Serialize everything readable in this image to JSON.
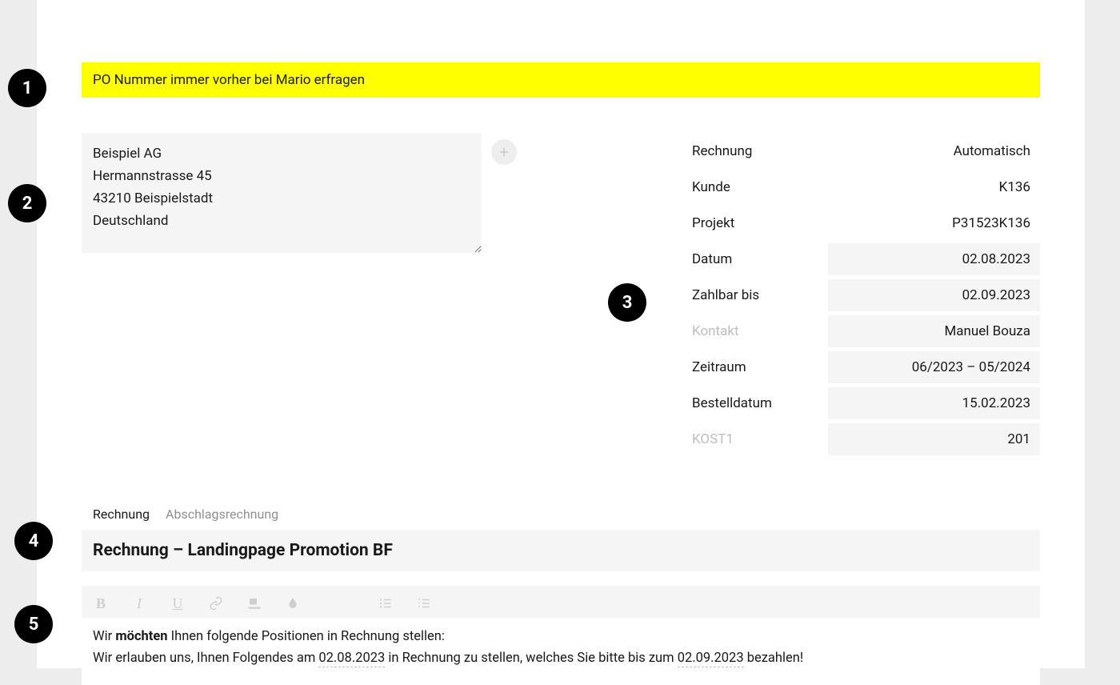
{
  "banner_text": "PO Nummer immer vorher bei Mario erfragen",
  "address_text": "Beispiel AG\nHermannstrasse 45\n43210 Beispielstadt\nDeutschland",
  "meta": {
    "rows": [
      {
        "label": "Rechnung",
        "value": "Automatisch",
        "boxed": false,
        "muted": false
      },
      {
        "label": "Kunde",
        "value": "K136",
        "boxed": false,
        "muted": false
      },
      {
        "label": "Projekt",
        "value": "P31523K136",
        "boxed": false,
        "muted": false
      },
      {
        "label": "Datum",
        "value": "02.08.2023",
        "boxed": true,
        "muted": false
      },
      {
        "label": "Zahlbar bis",
        "value": "02.09.2023",
        "boxed": true,
        "muted": false
      },
      {
        "label": "Kontakt",
        "value": "Manuel Bouza",
        "boxed": true,
        "muted": true
      },
      {
        "label": "Zeitraum",
        "value": "06/2023 – 05/2024",
        "boxed": true,
        "muted": false
      },
      {
        "label": "Bestelldatum",
        "value": "15.02.2023",
        "boxed": true,
        "muted": false
      },
      {
        "label": "KOST1",
        "value": "201",
        "boxed": true,
        "muted": true
      }
    ]
  },
  "tabs": {
    "invoice": "Rechnung",
    "partial": "Abschlagsrechnung"
  },
  "title": "Rechnung – Landingpage Promotion BF",
  "body": {
    "line1_prefix": "Wir ",
    "line1_bold": "möchten",
    "line1_suffix": " Ihnen folgende Positionen in Rechnung stellen:",
    "line2_a": "Wir erlauben uns, Ihnen Folgendes am ",
    "line2_date1": "02.08.2023",
    "line2_b": " in Rechnung zu stellen, welches Sie bitte bis zum ",
    "line2_date2": "02.09.2023",
    "line2_c": " bezahlen!"
  },
  "callouts": {
    "b1": "1",
    "b2": "2",
    "b3": "3",
    "b4": "4",
    "b5": "5"
  }
}
